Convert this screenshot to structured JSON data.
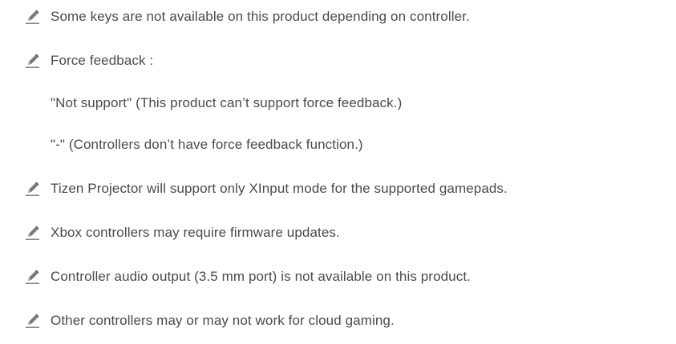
{
  "notes": [
    {
      "text": "Some keys are not available on this product depending on controller."
    },
    {
      "text": "Force feedback :"
    },
    {
      "text": "Tizen Projector will support only XInput mode for the supported gamepads."
    },
    {
      "text": "Xbox controllers may require firmware updates."
    },
    {
      "text": "Controller audio output (3.5 mm port) is not available on this product."
    },
    {
      "text": "Other controllers may or may not work for cloud gaming."
    }
  ],
  "force_feedback_details": [
    "\"Not support\" (This product can’t support force feedback.)",
    "\"-\" (Controllers don’t have force feedback function.)"
  ],
  "icon": "note-pencil-icon",
  "colors": {
    "text": "#4a4a4a",
    "icon": "#6e6e6e",
    "background": "#ffffff"
  }
}
